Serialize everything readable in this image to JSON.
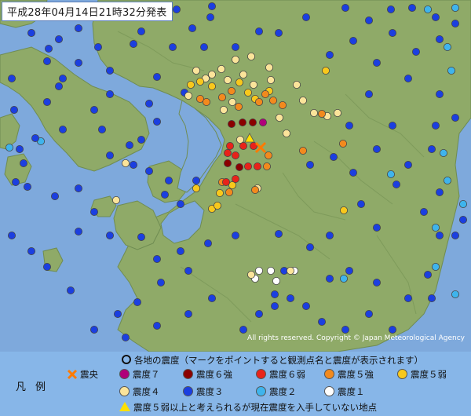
{
  "title": "平成28年04月14日21時32分発表",
  "copyright": "All rights reserved. Copyright © Japan Meteorological Agency",
  "legend": {
    "heading": "各地の震度（マークをポイントすると観測点名と震度が表示されます）",
    "label": "凡例",
    "epicenter": "震央",
    "items": [
      {
        "label": "震度７",
        "color": "#b0007a"
      },
      {
        "label": "震度６強",
        "color": "#8b0000"
      },
      {
        "label": "震度６弱",
        "color": "#e8231a"
      },
      {
        "label": "震度５強",
        "color": "#f28a1e"
      },
      {
        "label": "震度５弱",
        "color": "#f8c81c"
      },
      {
        "label": "震度４",
        "color": "#fbe49a"
      },
      {
        "label": "震度３",
        "color": "#1b3fe0"
      },
      {
        "label": "震度２",
        "color": "#3fb4ec"
      },
      {
        "label": "震度１",
        "color": "#ffffff"
      }
    ],
    "unreported": "震度５弱以上と考えられるが現在震度を入手していない地点"
  },
  "colors": {
    "sea": "#7ea9dc",
    "land": "#8faa68",
    "land_dark": "#6f8c52",
    "epicenter": "#ff7a00",
    "unreported": "#ffe000"
  },
  "stations": {
    "i7": [
      [
        335,
        156
      ]
    ],
    "i6p": [
      [
        295,
        158
      ],
      [
        309,
        156
      ],
      [
        322,
        156
      ],
      [
        290,
        208
      ],
      [
        305,
        213
      ]
    ],
    "i6m": [
      [
        293,
        186
      ],
      [
        310,
        186
      ],
      [
        323,
        186
      ],
      [
        300,
        198
      ],
      [
        290,
        195
      ],
      [
        316,
        212
      ],
      [
        328,
        212
      ],
      [
        300,
        228
      ],
      [
        288,
        232
      ]
    ],
    "i5p": [
      [
        255,
        126
      ],
      [
        263,
        130
      ],
      [
        283,
        124
      ],
      [
        295,
        116
      ],
      [
        304,
        136
      ],
      [
        330,
        130
      ],
      [
        338,
        120
      ],
      [
        348,
        128
      ],
      [
        360,
        134
      ],
      [
        386,
        192
      ],
      [
        342,
        198
      ],
      [
        340,
        212
      ],
      [
        292,
        245
      ],
      [
        283,
        232
      ],
      [
        325,
        242
      ],
      [
        437,
        183
      ],
      [
        410,
        145
      ]
    ],
    "i5m": [
      [
        243,
        108
      ],
      [
        270,
        110
      ],
      [
        305,
        105
      ],
      [
        316,
        118
      ],
      [
        325,
        126
      ],
      [
        343,
        116
      ],
      [
        415,
        90
      ],
      [
        280,
        246
      ],
      [
        270,
        266
      ],
      [
        277,
        262
      ],
      [
        296,
        236
      ],
      [
        438,
        268
      ],
      [
        255,
        104
      ],
      [
        250,
        240
      ]
    ],
    "i4": [
      [
        250,
        90
      ],
      [
        282,
        88
      ],
      [
        300,
        76
      ],
      [
        320,
        72
      ],
      [
        343,
        86
      ],
      [
        310,
        95
      ],
      [
        270,
        95
      ],
      [
        240,
        122
      ],
      [
        285,
        140
      ],
      [
        345,
        102
      ],
      [
        356,
        150
      ],
      [
        400,
        144
      ],
      [
        417,
        148
      ],
      [
        430,
        144
      ],
      [
        365,
        170
      ],
      [
        306,
        178
      ],
      [
        290,
        102
      ],
      [
        378,
        108
      ],
      [
        386,
        128
      ],
      [
        323,
        108
      ],
      [
        320,
        350
      ],
      [
        370,
        345
      ],
      [
        328,
        240
      ],
      [
        160,
        208
      ],
      [
        148,
        255
      ],
      [
        296,
        130
      ],
      [
        262,
        100
      ]
    ],
    "i3": [
      [
        12,
        22
      ],
      [
        30,
        12
      ],
      [
        40,
        42
      ],
      [
        62,
        62
      ],
      [
        75,
        50
      ],
      [
        100,
        36
      ],
      [
        130,
        10
      ],
      [
        160,
        8
      ],
      [
        205,
        22
      ],
      [
        225,
        12
      ],
      [
        245,
        36
      ],
      [
        270,
        8
      ],
      [
        268,
        22
      ],
      [
        330,
        40
      ],
      [
        355,
        42
      ],
      [
        390,
        22
      ],
      [
        440,
        10
      ],
      [
        470,
        26
      ],
      [
        498,
        12
      ],
      [
        525,
        10
      ],
      [
        555,
        22
      ],
      [
        580,
        30
      ],
      [
        125,
        60
      ],
      [
        170,
        56
      ],
      [
        180,
        40
      ],
      [
        220,
        60
      ],
      [
        260,
        60
      ],
      [
        300,
        60
      ],
      [
        420,
        70
      ],
      [
        450,
        52
      ],
      [
        500,
        42
      ],
      [
        530,
        66
      ],
      [
        560,
        50
      ],
      [
        15,
        100
      ],
      [
        60,
        78
      ],
      [
        80,
        100
      ],
      [
        100,
        80
      ],
      [
        140,
        90
      ],
      [
        200,
        98
      ],
      [
        235,
        118
      ],
      [
        18,
        140
      ],
      [
        60,
        130
      ],
      [
        80,
        165
      ],
      [
        120,
        140
      ],
      [
        140,
        120
      ],
      [
        190,
        132
      ],
      [
        200,
        155
      ],
      [
        180,
        178
      ],
      [
        140,
        198
      ],
      [
        165,
        185
      ],
      [
        170,
        210
      ],
      [
        30,
        208
      ],
      [
        20,
        232
      ],
      [
        35,
        238
      ],
      [
        190,
        218
      ],
      [
        215,
        230
      ],
      [
        210,
        248
      ],
      [
        230,
        260
      ],
      [
        250,
        230
      ],
      [
        480,
        80
      ],
      [
        520,
        100
      ],
      [
        560,
        120
      ],
      [
        580,
        150
      ],
      [
        470,
        120
      ],
      [
        500,
        160
      ],
      [
        450,
        220
      ],
      [
        480,
        190
      ],
      [
        520,
        210
      ],
      [
        550,
        190
      ],
      [
        505,
        235
      ],
      [
        560,
        245
      ],
      [
        540,
        270
      ],
      [
        590,
        280
      ],
      [
        580,
        300
      ],
      [
        480,
        290
      ],
      [
        420,
        300
      ],
      [
        395,
        315
      ],
      [
        370,
        380
      ],
      [
        390,
        390
      ],
      [
        420,
        355
      ],
      [
        445,
        345
      ],
      [
        480,
        360
      ],
      [
        520,
        380
      ],
      [
        545,
        350
      ],
      [
        550,
        380
      ],
      [
        500,
        420
      ],
      [
        470,
        400
      ],
      [
        440,
        420
      ],
      [
        410,
        410
      ],
      [
        330,
        400
      ],
      [
        310,
        420
      ],
      [
        270,
        380
      ],
      [
        240,
        400
      ],
      [
        200,
        415
      ],
      [
        160,
        430
      ],
      [
        150,
        400
      ],
      [
        120,
        420
      ],
      [
        90,
        370
      ],
      [
        60,
        340
      ],
      [
        40,
        320
      ],
      [
        15,
        300
      ],
      [
        70,
        250
      ],
      [
        100,
        240
      ],
      [
        120,
        270
      ],
      [
        140,
        300
      ],
      [
        100,
        295
      ],
      [
        180,
        302
      ],
      [
        200,
        330
      ],
      [
        230,
        320
      ],
      [
        240,
        345
      ],
      [
        265,
        310
      ],
      [
        300,
        300
      ],
      [
        205,
        360
      ],
      [
        175,
        385
      ],
      [
        350,
        390
      ],
      [
        460,
        260
      ],
      [
        425,
        200
      ],
      [
        395,
        210
      ],
      [
        355,
        298
      ],
      [
        362,
        345
      ],
      [
        350,
        375
      ],
      [
        75,
        110
      ],
      [
        45,
        176
      ],
      [
        25,
        190
      ],
      [
        130,
        165
      ],
      [
        445,
        160
      ],
      [
        560,
        300
      ],
      [
        555,
        160
      ]
    ],
    "i2": [
      [
        15,
        20
      ],
      [
        580,
        10
      ],
      [
        545,
        12
      ],
      [
        565,
        195
      ],
      [
        570,
        230
      ],
      [
        590,
        260
      ],
      [
        555,
        290
      ],
      [
        580,
        375
      ],
      [
        555,
        340
      ],
      [
        52,
        180
      ],
      [
        12,
        188
      ],
      [
        570,
        60
      ],
      [
        575,
        90
      ],
      [
        438,
        355
      ],
      [
        498,
        222
      ]
    ],
    "i1": [
      [
        345,
        345
      ],
      [
        352,
        358
      ],
      [
        330,
        345
      ],
      [
        375,
        345
      ],
      [
        325,
        355
      ]
    ],
    "epicenter": [
      [
        332,
        188
      ]
    ],
    "unreported": [
      [
        318,
        176
      ]
    ]
  }
}
